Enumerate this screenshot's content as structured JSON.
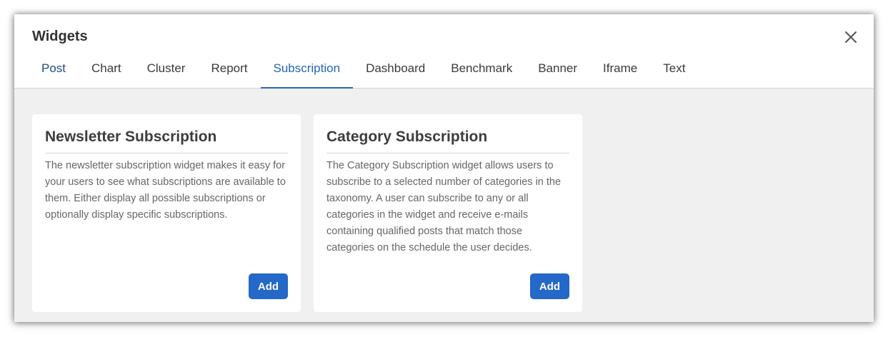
{
  "modal": {
    "title": "Widgets",
    "close_icon": "close-icon"
  },
  "tabs": [
    {
      "label": "Post"
    },
    {
      "label": "Chart"
    },
    {
      "label": "Cluster"
    },
    {
      "label": "Report"
    },
    {
      "label": "Subscription",
      "active": true
    },
    {
      "label": "Dashboard"
    },
    {
      "label": "Benchmark"
    },
    {
      "label": "Banner"
    },
    {
      "label": "Iframe"
    },
    {
      "label": "Text"
    }
  ],
  "cards": [
    {
      "title": "Newsletter Subscription",
      "description": "The newsletter subscription widget makes it easy for your users to see what subscriptions are available to them. Either display all possible subscriptions or optionally display specific subscriptions.",
      "button_label": "Add"
    },
    {
      "title": "Category Subscription",
      "description": "The Category Subscription widget allows users to subscribe to a selected number of categories in the taxonomy. A user can subscribe to any or all categories in the widget and receive e-mails containing qualified posts that match those categories on the schedule the user decides.",
      "button_label": "Add"
    }
  ],
  "colors": {
    "accent": "#2466b8",
    "button": "#2468c8",
    "content_background": "#f0f0f0"
  }
}
